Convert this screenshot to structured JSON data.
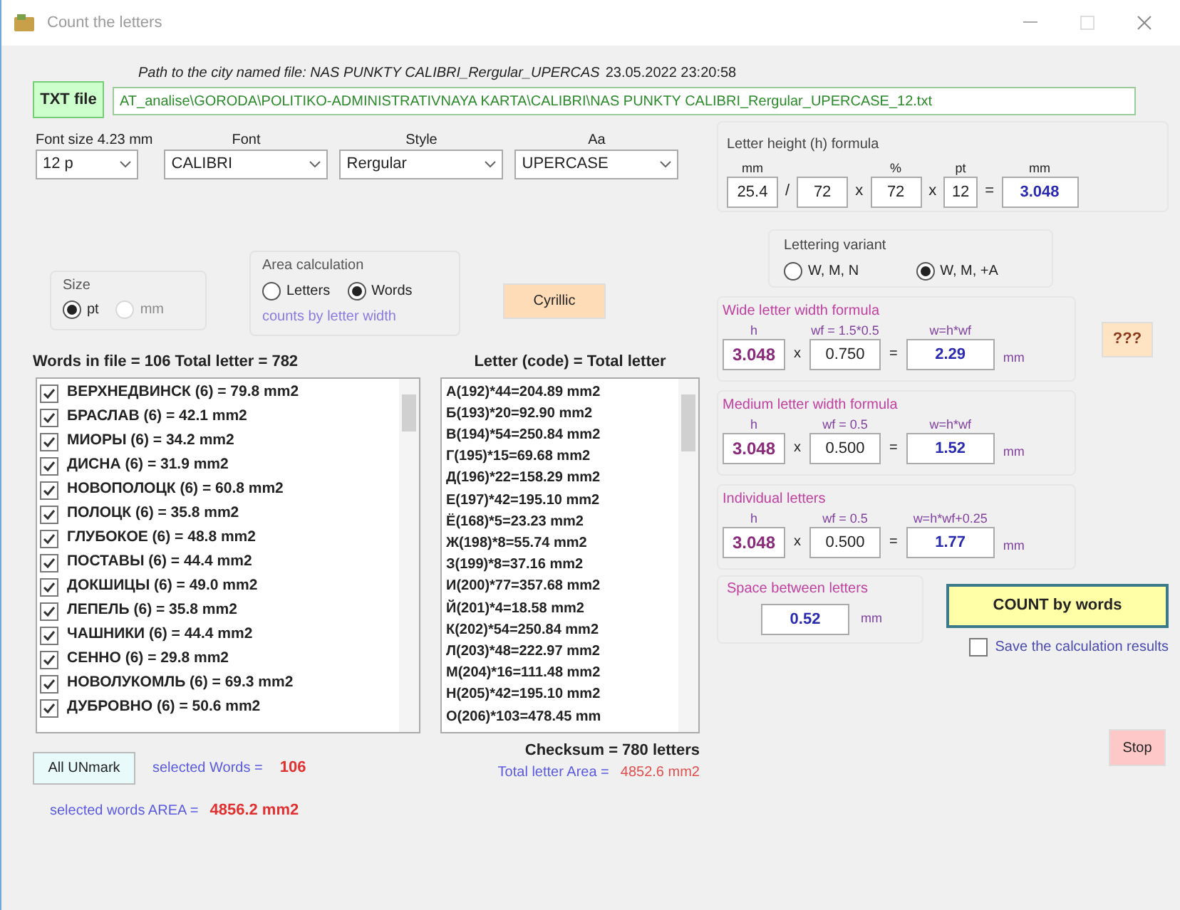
{
  "window": {
    "title": "Count the letters"
  },
  "file": {
    "button": "TXT file",
    "path_label": "Path to the city named file:  NAS PUNKTY CALIBRI_Rergular_UPERCAS",
    "timestamp": "23.05.2022 23:20:58",
    "path": "AT_analise\\GORODA\\POLITIKO-ADMINISTRATIVNAYA KARTA\\CALIBRI\\NAS PUNKTY CALIBRI_Rergular_UPERCASE_12.txt"
  },
  "font_settings": [
    {
      "label": "Font size  4.23 mm",
      "value": "12 p"
    },
    {
      "label": "Font",
      "value": "CALIBRI"
    },
    {
      "label": "Style",
      "value": "Rergular"
    },
    {
      "label": "Aa",
      "value": "UPERCASE"
    }
  ],
  "size_group": {
    "title": "Size",
    "options": [
      {
        "label": "pt",
        "selected": true,
        "disabled": false
      },
      {
        "label": "mm",
        "selected": false,
        "disabled": true
      }
    ]
  },
  "area_calculation": {
    "title": "Area calculation",
    "options": [
      {
        "label": "Letters",
        "selected": false
      },
      {
        "label": "Words",
        "selected": true
      }
    ],
    "note": "counts by letter width"
  },
  "cyrillic_button": "Cyrillic",
  "words": {
    "header": "Words in file = 106  Total letter = 782",
    "items": [
      {
        "text": "ВЕРХНЕДВИНСК (6) = 79.8 mm2",
        "checked": true
      },
      {
        "text": "БРАСЛАВ (6) = 42.1 mm2",
        "checked": true
      },
      {
        "text": "МИОРЫ (6) = 34.2 mm2",
        "checked": true
      },
      {
        "text": "ДИСНА (6) = 31.9 mm2",
        "checked": true
      },
      {
        "text": "НОВОПОЛОЦК (6) = 60.8 mm2",
        "checked": true
      },
      {
        "text": "ПОЛОЦК (6) = 35.8 mm2",
        "checked": true
      },
      {
        "text": "ГЛУБОКОЕ (6) = 48.8 mm2",
        "checked": true
      },
      {
        "text": "ПОСТАВЫ (6) = 44.4 mm2",
        "checked": true
      },
      {
        "text": "ДОКШИЦЫ (6) = 49.0 mm2",
        "checked": true
      },
      {
        "text": "ЛЕПЕЛЬ (6) = 35.8 mm2",
        "checked": true
      },
      {
        "text": "ЧАШНИКИ (6) = 44.4 mm2",
        "checked": true
      },
      {
        "text": "СЕННО (6) = 29.8 mm2",
        "checked": true
      },
      {
        "text": "НОВОЛУКОМЛЬ (6) = 69.3 mm2",
        "checked": true
      },
      {
        "text": "ДУБРОВНО (6) = 50.6 mm2",
        "checked": true
      }
    ]
  },
  "letters": {
    "header": "Letter (code) = Total letter",
    "items": [
      "А(192)*44=204.89 mm2",
      "Б(193)*20=92.90 mm2",
      "В(194)*54=250.84 mm2",
      "Г(195)*15=69.68 mm2",
      "Д(196)*22=158.29 mm2",
      "Е(197)*42=195.10 mm2",
      "Ё(168)*5=23.23 mm2",
      "Ж(198)*8=55.74 mm2",
      "З(199)*8=37.16 mm2",
      "И(200)*77=357.68 mm2",
      "Й(201)*4=18.58 mm2",
      "К(202)*54=250.84 mm2",
      "Л(203)*48=222.97 mm2",
      "М(204)*16=111.48 mm2",
      "Н(205)*42=195.10 mm2",
      "О(206)*103=478.45 mm"
    ],
    "checksum": "Checksum = 780 letters",
    "area_label": "Total letter Area = ",
    "area_value": "4852.6 mm2"
  },
  "unmark_button": "All UNmark",
  "selected_words": {
    "label": "selected Words = ",
    "value": "106"
  },
  "selected_area": {
    "label": "selected words AREA = ",
    "value": "4856.2 mm2"
  },
  "height_formula": {
    "title": "Letter height (h) formula",
    "fields": [
      {
        "label": "mm",
        "value": "25.4",
        "op": "/",
        "kind": "input"
      },
      {
        "value": "72",
        "op": "x",
        "kind": "input"
      },
      {
        "label": "%",
        "value": "72",
        "op": "x",
        "kind": "input"
      },
      {
        "label": "pt",
        "value": "12",
        "op": "=",
        "kind": "input"
      },
      {
        "label": "mm",
        "value": "3.048",
        "kind": "result"
      }
    ]
  },
  "lettering_variant": {
    "title": "Lettering variant",
    "options": [
      {
        "label": "W, M, N",
        "selected": false
      },
      {
        "label": "W, M, +A",
        "selected": true
      }
    ]
  },
  "width_formulas": [
    {
      "title": "Wide letter width formula",
      "h_label": "h",
      "h": "3.048",
      "op": "x",
      "coef_label": "wf = 1.5*0.5",
      "coef": "0.750",
      "eq": "=",
      "result_label": "w=h*wf",
      "result": "2.29",
      "unit": "mm"
    },
    {
      "title": "Medium letter width formula",
      "h_label": "h",
      "h": "3.048",
      "op": "x",
      "coef_label": "wf = 0.5",
      "coef": "0.500",
      "eq": "=",
      "result_label": "w=h*wf",
      "result": "1.52",
      "unit": "mm"
    },
    {
      "title": "Individual letters",
      "h_label": "h",
      "h": "3.048",
      "op": "x",
      "coef_label": "wf = 0.5",
      "coef": "0.500",
      "eq": "=",
      "result_label": "w=h*wf+0.25",
      "result": "1.77",
      "unit": "mm"
    }
  ],
  "help_button": "???",
  "spacing": {
    "title": "Space between letters",
    "value": "0.52",
    "unit": "mm"
  },
  "count_button": "COUNT by words",
  "save_results": {
    "label": "Save the calculation results",
    "checked": false
  },
  "stop_button": "Stop"
}
